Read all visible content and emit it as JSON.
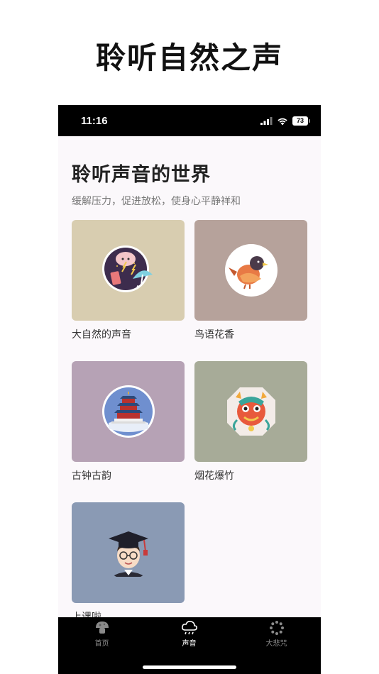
{
  "promo": {
    "title": "聆听自然之声"
  },
  "status_bar": {
    "time": "11:16",
    "battery": "73"
  },
  "page": {
    "heading": "聆听声音的世界",
    "subtitle": "缓解压力，促进放松，使身心平静祥和"
  },
  "cards": [
    {
      "label": "大自然的声音",
      "bg": "#d8cdb0",
      "icon": "nature-weather-icon"
    },
    {
      "label": "鸟语花香",
      "bg": "#b6a29b",
      "icon": "bird-icon"
    },
    {
      "label": "古钟古韵",
      "bg": "#b6a2b5",
      "icon": "temple-icon"
    },
    {
      "label": "烟花爆竹",
      "bg": "#a7ab98",
      "icon": "dragon-icon"
    },
    {
      "label": "上课啦",
      "bg": "#8a9ab4",
      "icon": "graduate-icon"
    }
  ],
  "tabs": [
    {
      "label": "首页",
      "icon": "mushroom-icon",
      "active": false
    },
    {
      "label": "声音",
      "icon": "cloud-rain-icon",
      "active": true
    },
    {
      "label": "大悲咒",
      "icon": "beads-icon",
      "active": false
    }
  ]
}
